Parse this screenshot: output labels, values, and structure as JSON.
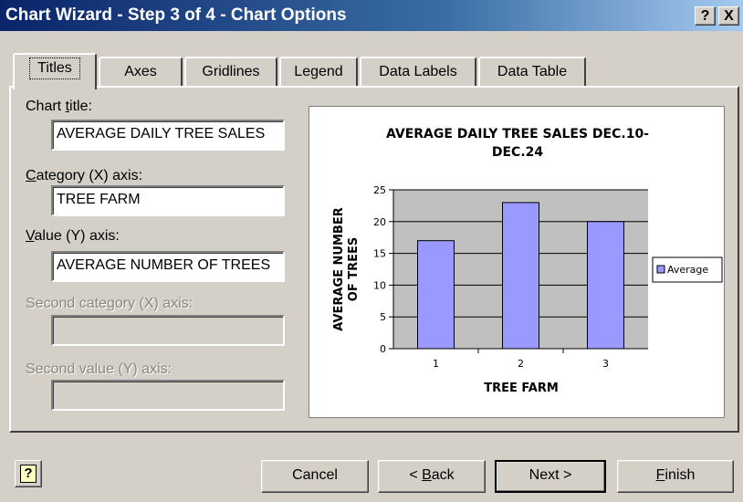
{
  "window": {
    "title": "Chart Wizard - Step 3 of 4 - Chart Options",
    "help_button": "?",
    "close_button": "X"
  },
  "tabs": [
    "Titles",
    "Axes",
    "Gridlines",
    "Legend",
    "Data Labels",
    "Data Table"
  ],
  "fields": {
    "chart_title": {
      "label_pre": "Chart ",
      "label_key": "t",
      "label_post": "itle:",
      "value": "AVERAGE DAILY TREE SALES"
    },
    "category_x": {
      "label_pre": "",
      "label_key": "C",
      "label_post": "ategory (X) axis:",
      "value": "TREE FARM"
    },
    "value_y": {
      "label_pre": "",
      "label_key": "V",
      "label_post": "alue (Y) axis:",
      "value": "AVERAGE NUMBER OF TREES"
    },
    "second_category_x": {
      "label": "Second category (X) axis:",
      "value": ""
    },
    "second_value_y": {
      "label": "Second value (Y) axis:",
      "value": ""
    }
  },
  "buttons": {
    "cancel": "Cancel",
    "back_pre": "< ",
    "back_key": "B",
    "back_post": "ack",
    "next": "Next >",
    "finish_key": "F",
    "finish_post": "inish"
  },
  "chart_data": {
    "type": "bar",
    "title": "AVERAGE DAILY TREE SALES DEC.10-DEC.24",
    "title_lines": [
      "AVERAGE DAILY TREE SALES DEC.10-",
      "DEC.24"
    ],
    "xlabel": "TREE FARM",
    "ylabel": "AVERAGE NUMBER OF TREES",
    "ylabel_lines": [
      "AVERAGE NUMBER",
      "OF TREES"
    ],
    "categories": [
      "1",
      "2",
      "3"
    ],
    "series": [
      {
        "name": "Average",
        "values": [
          17,
          23,
          20
        ]
      }
    ],
    "ylim": [
      0,
      25
    ],
    "yticks": [
      0,
      5,
      10,
      15,
      20,
      25
    ],
    "grid": true,
    "legend_position": "right",
    "bar_color": "#9999ff",
    "plot_bg": "#c0c0c0"
  }
}
